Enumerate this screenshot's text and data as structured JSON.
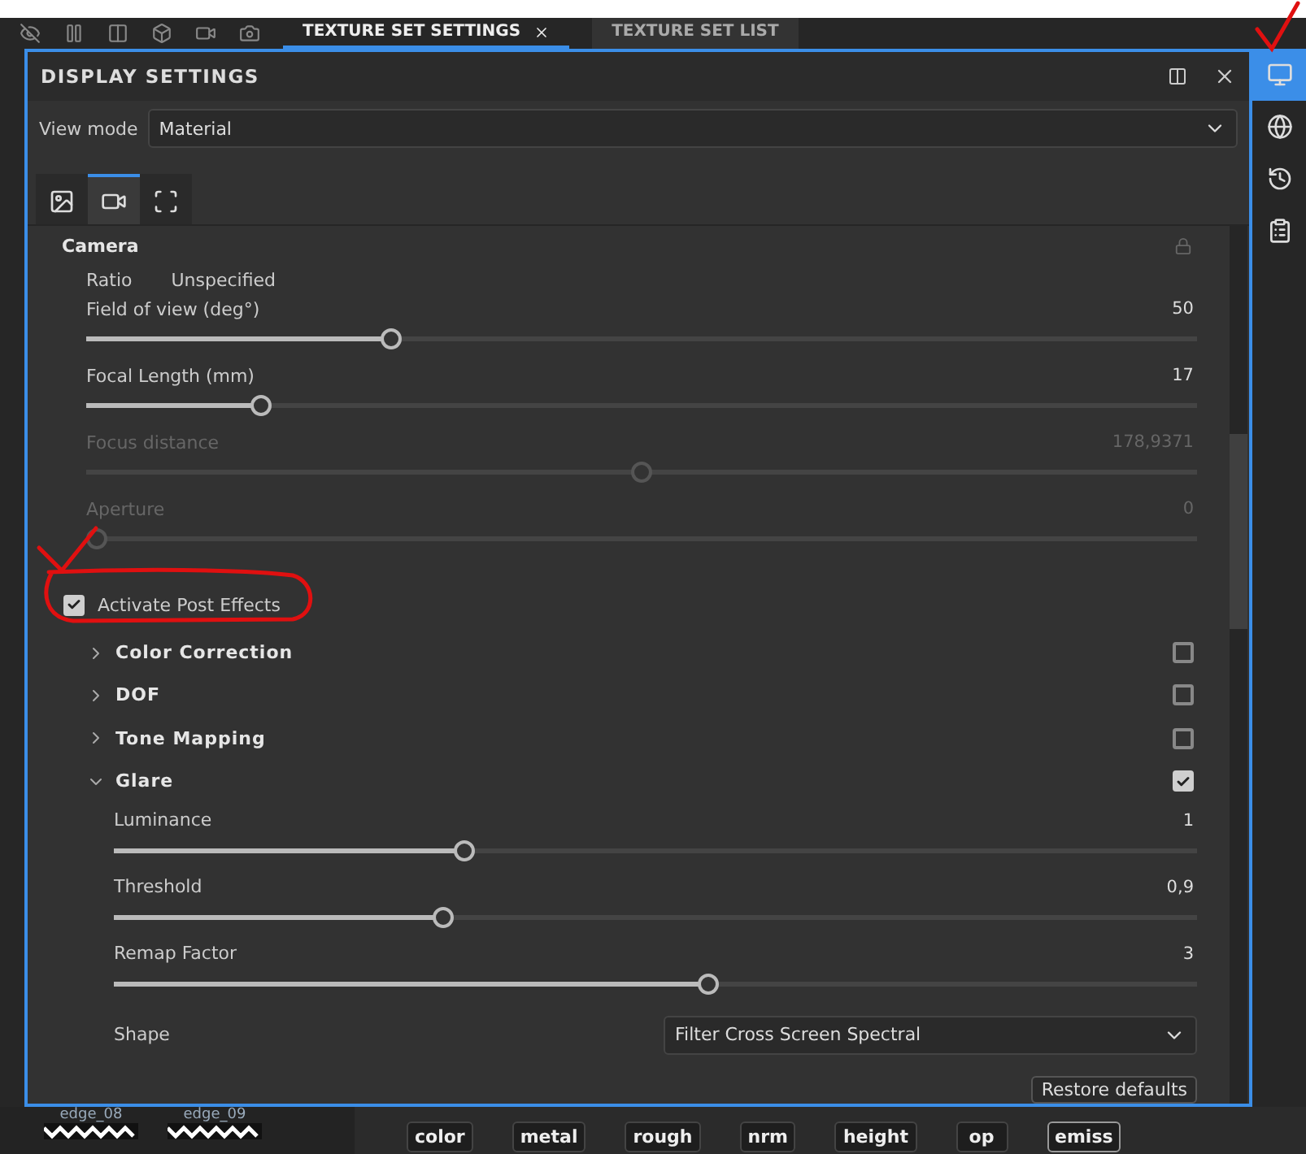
{
  "top_tabs": [
    {
      "label": "TEXTURE SET SETTINGS",
      "selected": true
    },
    {
      "label": "TEXTURE SET LIST",
      "selected": false
    }
  ],
  "panel": {
    "title": "DISPLAY SETTINGS",
    "view_mode": {
      "label": "View mode",
      "value": "Material"
    },
    "tabs": [
      {
        "kind": "environment",
        "selected": false
      },
      {
        "kind": "camera",
        "selected": true
      },
      {
        "kind": "viewport",
        "selected": false
      }
    ],
    "camera": {
      "title": "Camera",
      "ratio": {
        "label": "Ratio",
        "value": "Unspecified"
      },
      "sliders": [
        {
          "label": "Field of view (deg°)",
          "value": "50",
          "level": 0.27,
          "disabled": false
        },
        {
          "label": "Focal Length (mm)",
          "value": "17",
          "level": 0.15,
          "disabled": false
        },
        {
          "label": "Focus distance",
          "value": "178,9371",
          "level": 0.5,
          "disabled": true
        },
        {
          "label": "Aperture",
          "value": "0",
          "level": 0,
          "disabled": true
        }
      ]
    },
    "post_effects": {
      "label": "Activate Post Effects",
      "checked": true
    },
    "sections": [
      {
        "title": "Color Correction",
        "expanded": false,
        "checked": false
      },
      {
        "title": "DOF",
        "expanded": false,
        "checked": false
      },
      {
        "title": "Tone Mapping",
        "expanded": false,
        "checked": false
      },
      {
        "title": "Glare",
        "expanded": true,
        "checked": true,
        "sliders": [
          {
            "label": "Luminance",
            "value": "1",
            "level": 0.32,
            "disabled": false
          },
          {
            "label": "Threshold",
            "value": "0,9",
            "level": 0.3,
            "disabled": false
          },
          {
            "label": "Remap Factor",
            "value": "3",
            "level": 0.55,
            "disabled": false
          }
        ],
        "dropdown": {
          "label": "Shape",
          "value": "Filter Cross Screen Spectral"
        }
      }
    ],
    "restore_button": "Restore defaults"
  },
  "sidebar": [
    {
      "kind": "display",
      "selected": true
    },
    {
      "kind": "environment",
      "selected": false
    },
    {
      "kind": "history",
      "selected": false
    },
    {
      "kind": "log",
      "selected": false
    }
  ],
  "textures": [
    "edge_08",
    "edge_09"
  ],
  "channels": [
    {
      "label": "color",
      "selected": false
    },
    {
      "label": "metal",
      "selected": false
    },
    {
      "label": "rough",
      "selected": false
    },
    {
      "label": "nrm",
      "selected": false
    },
    {
      "label": "height",
      "selected": false
    },
    {
      "label": "op",
      "selected": false
    },
    {
      "label": "emiss",
      "selected": true
    }
  ]
}
